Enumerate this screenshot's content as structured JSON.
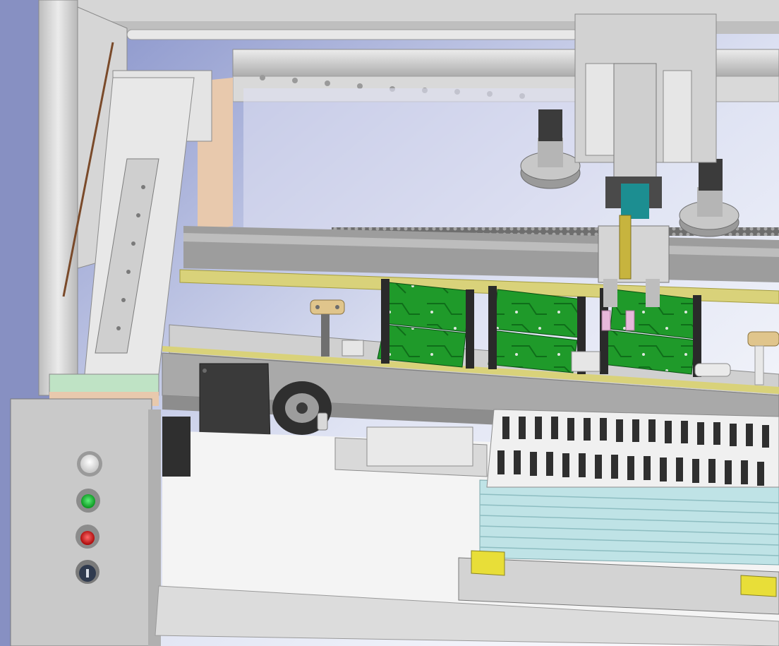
{
  "scene": {
    "description_free": true,
    "colors": {
      "background_gradient_start": "#8f9ad0",
      "background_gradient_end": "#ffffff",
      "frame_gray": "#c9c9c9",
      "frame_light": "#e6e6e6",
      "frame_dark": "#8a8a8a",
      "pcb_green": "#1f9a2a",
      "pcb_dark": "#0f6e1a",
      "rail_yellow": "#d9d27a",
      "motor_black": "#3a3a3a",
      "tray_cyan": "#bfe3e6",
      "wood_tan": "#e8c9ad",
      "accent_yellow": "#e8de38",
      "button_green": "#18b82e",
      "button_red": "#d81e1e",
      "button_white": "#f4f4f4"
    },
    "panel_buttons": [
      {
        "name": "white-indicator-button",
        "color": "#f4f4f4"
      },
      {
        "name": "green-start-button",
        "color": "#18b82e"
      },
      {
        "name": "red-stop-button",
        "color": "#d81e1e"
      },
      {
        "name": "key-switch",
        "color": "#cfd4dd"
      }
    ]
  }
}
